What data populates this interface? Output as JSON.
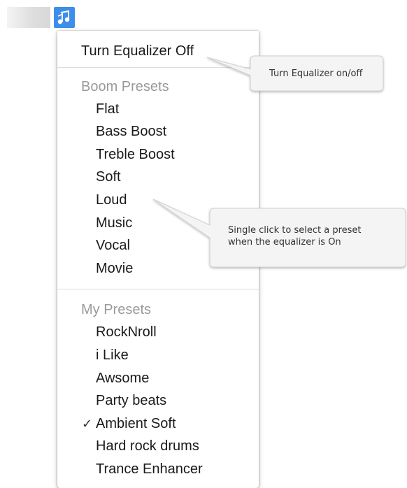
{
  "menu": {
    "toggle_label": "Turn Equalizer Off",
    "boom_header": "Boom Presets",
    "boom_presets": [
      "Flat",
      "Bass Boost",
      "Treble Boost",
      "Soft",
      "Loud",
      "Music",
      "Vocal",
      "Movie"
    ],
    "my_header": "My Presets",
    "my_presets": [
      "RockNroll",
      "i Like",
      "Awsome",
      "Party beats",
      "Ambient Soft",
      "Hard rock drums",
      "Trance Enhancer"
    ],
    "checked_item": "Ambient Soft",
    "check_glyph": "✓"
  },
  "callouts": {
    "toggle_tip": "Turn Equalizer on/off",
    "preset_tip_line1": "Single click to select a preset",
    "preset_tip_line2": "when the equalizer is On"
  },
  "icons": {
    "menubar_icon": "equalizer-app-icon"
  },
  "colors": {
    "icon_bg": "#3d8ee8",
    "header_text": "#9a9a9a",
    "item_text": "#1a1a1a"
  }
}
